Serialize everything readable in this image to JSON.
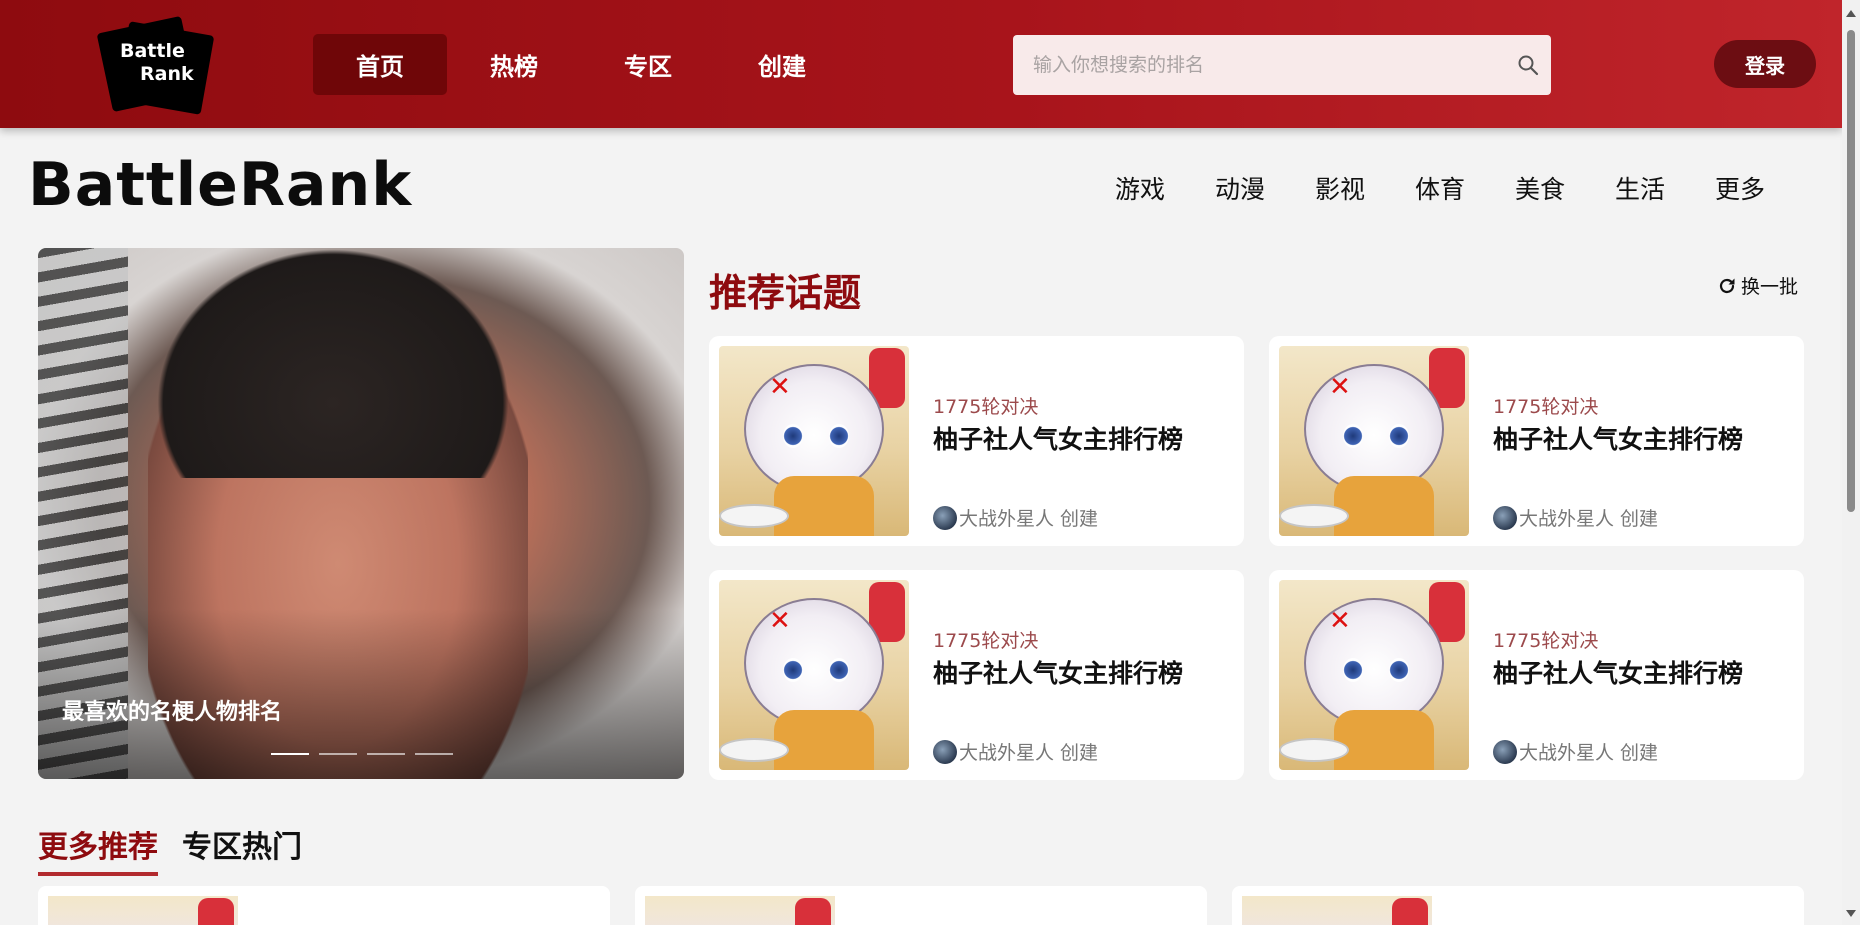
{
  "header": {
    "logo_line1": "Battle",
    "logo_line2": "Rank",
    "nav": [
      {
        "label": "首页",
        "active": true
      },
      {
        "label": "热榜",
        "active": false
      },
      {
        "label": "专区",
        "active": false
      },
      {
        "label": "创建",
        "active": false
      }
    ],
    "search_placeholder": "输入你想搜索的排名",
    "login_label": "登录"
  },
  "brand": "BattleRank",
  "categories": [
    "游戏",
    "动漫",
    "影视",
    "体育",
    "美食",
    "生活",
    "更多"
  ],
  "carousel": {
    "caption": "最喜欢的名梗人物排名",
    "slides": 4,
    "active_slide": 1
  },
  "recommended": {
    "title": "推荐话题",
    "refresh_label": "换一批",
    "cards": [
      {
        "round": "1775轮对决",
        "title": "柚子社人气女主排行榜",
        "author": "大战外星人 创建"
      },
      {
        "round": "1775轮对决",
        "title": "柚子社人气女主排行榜",
        "author": "大战外星人 创建"
      },
      {
        "round": "1775轮对决",
        "title": "柚子社人气女主排行榜",
        "author": "大战外星人 创建"
      },
      {
        "round": "1775轮对决",
        "title": "柚子社人气女主排行榜",
        "author": "大战外星人 创建"
      }
    ]
  },
  "tabs": [
    {
      "label": "更多推荐",
      "active": true
    },
    {
      "label": "专区热门",
      "active": false
    }
  ],
  "colors": {
    "brand_red": "#8e0b0f",
    "header_gradient_end": "#c0252b",
    "login_bg": "#6c0d12"
  }
}
